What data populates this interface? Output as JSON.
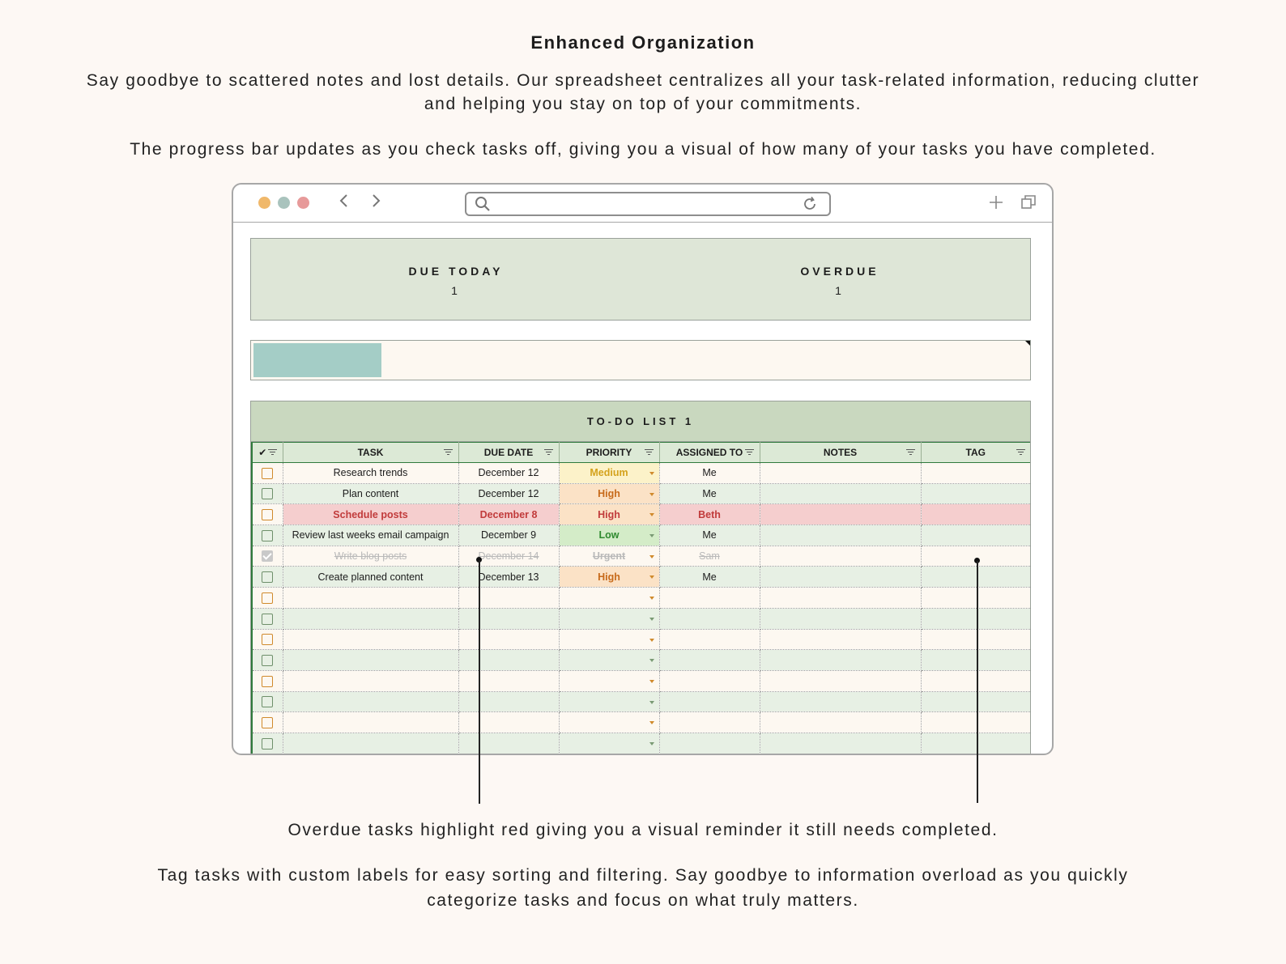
{
  "heading": "Enhanced Organization",
  "paragraphs": {
    "intro": "Say goodbye to scattered notes and lost details. Our spreadsheet centralizes all your task-related information, reducing clutter and helping you stay on top of your commitments.",
    "progress": "The progress bar updates as you check tasks off, giving you a visual of how many of your tasks you have completed.",
    "overdue": "Overdue tasks highlight red giving you a visual reminder it still needs completed.",
    "tags": "Tag tasks with custom labels for easy sorting and filtering. Say goodbye to information overload as you quickly categorize tasks and focus on what truly matters."
  },
  "browser": {
    "dots": [
      "#f0b86a",
      "#a9c3bd",
      "#e79a9a"
    ],
    "icons": [
      "back-chevron-icon",
      "forward-chevron-icon",
      "search-icon",
      "reload-icon",
      "new-tab-plus-icon",
      "tabs-copy-icon"
    ],
    "url": ""
  },
  "summary": {
    "due_today_label": "DUE TODAY",
    "due_today_value": "1",
    "overdue_label": "OVERDUE",
    "overdue_value": "1"
  },
  "progress": {
    "fraction": 0.165,
    "color": "#a4cdc6"
  },
  "todo": {
    "title": "TO-DO LIST 1",
    "headers": {
      "check": "✔",
      "task": "TASK",
      "due": "DUE DATE",
      "priority": "PRIORITY",
      "assigned": "ASSIGNED TO",
      "notes": "NOTES",
      "tag": "TAG"
    },
    "rows": [
      {
        "task": "Research trends",
        "due": "December 12",
        "priority": "Medium",
        "assigned": "Me"
      },
      {
        "task": "Plan content",
        "due": "December 12",
        "priority": "High",
        "assigned": "Me"
      },
      {
        "task": "Schedule posts",
        "due": "December 8",
        "priority": "High",
        "assigned": "Beth"
      },
      {
        "task": "Review last weeks email campaign",
        "due": "December 9",
        "priority": "Low",
        "assigned": "Me"
      },
      {
        "task": "Write blog posts",
        "due": "December 14",
        "priority": "Urgent",
        "assigned": "Sam"
      },
      {
        "task": "Create planned content",
        "due": "December 13",
        "priority": "High",
        "assigned": "Me"
      }
    ]
  }
}
